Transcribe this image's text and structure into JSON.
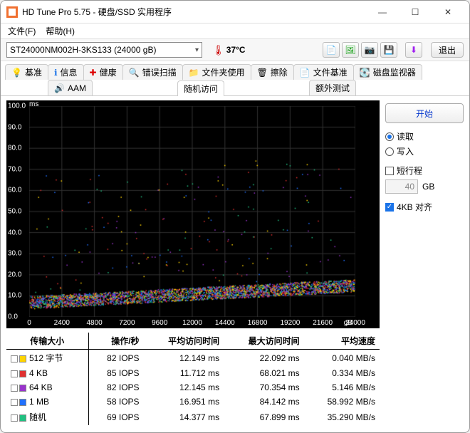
{
  "window": {
    "title": "HD Tune Pro 5.75 - 硬盘/SSD 实用程序"
  },
  "menu": {
    "file": "文件(F)",
    "help": "帮助(H)"
  },
  "drive": {
    "text": "ST24000NM002H-3KS133 (24000 gB)"
  },
  "temp": {
    "value": "37°C"
  },
  "exit_label": "退出",
  "tabs": {
    "row1": [
      "基准",
      "信息",
      "健康",
      "错误扫描",
      "文件夹使用",
      "擦除",
      "文件基准",
      "磁盘监视器"
    ],
    "row2": [
      "AAM",
      "随机访问",
      "额外测试"
    ]
  },
  "tab_icons1": [
    "💡",
    "ℹ️",
    "➕",
    "🔍",
    "📁",
    "🧹",
    "📄",
    "💽"
  ],
  "tab_icons2": [
    "🔊",
    "",
    ""
  ],
  "controls": {
    "start": "开始",
    "read": "读取",
    "write": "写入",
    "short": "短行程",
    "short_value": "40",
    "short_unit": "GB",
    "align": "4KB 对齐"
  },
  "table": {
    "headers": [
      "传输大小",
      "操作/秒",
      "平均访问时间",
      "最大访问时间",
      "平均速度"
    ],
    "rows": [
      {
        "color": "#ffd400",
        "label": "512 字节",
        "iops": "82 IOPS",
        "avg": "12.149 ms",
        "max": "22.092 ms",
        "speed": "0.040 MB/s"
      },
      {
        "color": "#e03030",
        "label": "4 KB",
        "iops": "85 IOPS",
        "avg": "11.712 ms",
        "max": "68.021 ms",
        "speed": "0.334 MB/s"
      },
      {
        "color": "#9933cc",
        "label": "64 KB",
        "iops": "82 IOPS",
        "avg": "12.145 ms",
        "max": "70.354 ms",
        "speed": "5.146 MB/s"
      },
      {
        "color": "#2070ff",
        "label": "1 MB",
        "iops": "58 IOPS",
        "avg": "16.951 ms",
        "max": "84.142 ms",
        "speed": "58.992 MB/s"
      },
      {
        "color": "#20c080",
        "label": "随机",
        "iops": "69 IOPS",
        "avg": "14.377 ms",
        "max": "67.899 ms",
        "speed": "35.290 MB/s"
      }
    ]
  },
  "chart_data": {
    "type": "scatter",
    "title": "",
    "xlabel": "gB",
    "ylabel": "ms",
    "xlim": [
      0,
      24000
    ],
    "ylim": [
      0,
      100
    ],
    "xticks": [
      0,
      2400,
      4800,
      7200,
      9600,
      12000,
      14400,
      16800,
      19200,
      21600,
      24000
    ],
    "yticks": [
      0,
      10,
      20,
      30,
      40,
      50,
      60,
      70,
      80,
      90,
      100
    ],
    "series": [
      {
        "name": "512 字节",
        "color": "#ffd400",
        "baseline_ms": [
          6,
          14
        ],
        "max_ms": 22
      },
      {
        "name": "4 KB",
        "color": "#e03030",
        "baseline_ms": [
          6,
          14
        ],
        "max_ms": 68
      },
      {
        "name": "64 KB",
        "color": "#9933cc",
        "baseline_ms": [
          6,
          15
        ],
        "max_ms": 70
      },
      {
        "name": "1 MB",
        "color": "#2070ff",
        "baseline_ms": [
          8,
          22
        ],
        "max_ms": 84
      },
      {
        "name": "随机",
        "color": "#20c080",
        "baseline_ms": [
          6,
          18
        ],
        "max_ms": 68
      }
    ],
    "note": "dense multicolor scatter; band rises from ~6ms at x=0 to ~14ms at x=24000 with sporadic outliers up to ~80ms"
  }
}
